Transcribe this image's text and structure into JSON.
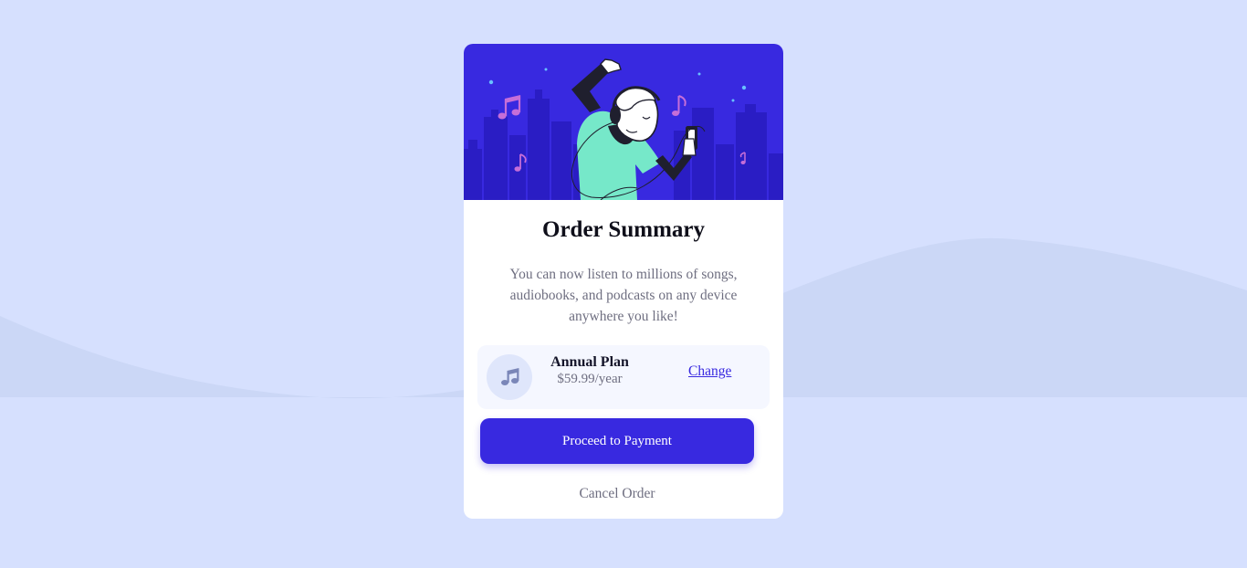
{
  "colors": {
    "page_background": "#d6e0fe",
    "background_wave": "#cbd7f6",
    "card_background": "#ffffff",
    "hero_background": "#3829e0",
    "primary": "#3829e0",
    "text_dark": "#141429",
    "text_muted": "#6e6e80",
    "plan_box": "#f5f7ff",
    "figure_shirt": "#76e8c9",
    "music_notes": "#c66ed8"
  },
  "icons": {
    "hero": "dancing-person-with-headphones-illustration",
    "plan": "music-note-icon"
  },
  "card": {
    "title": "Order Summary",
    "description": "You can now listen to millions of songs, audiobooks, and podcasts on any device anywhere you like!",
    "plan": {
      "name": "Annual Plan",
      "price": "$59.99/year",
      "change_label": "Change"
    },
    "proceed_label": "Proceed to Payment",
    "cancel_label": "Cancel Order"
  }
}
